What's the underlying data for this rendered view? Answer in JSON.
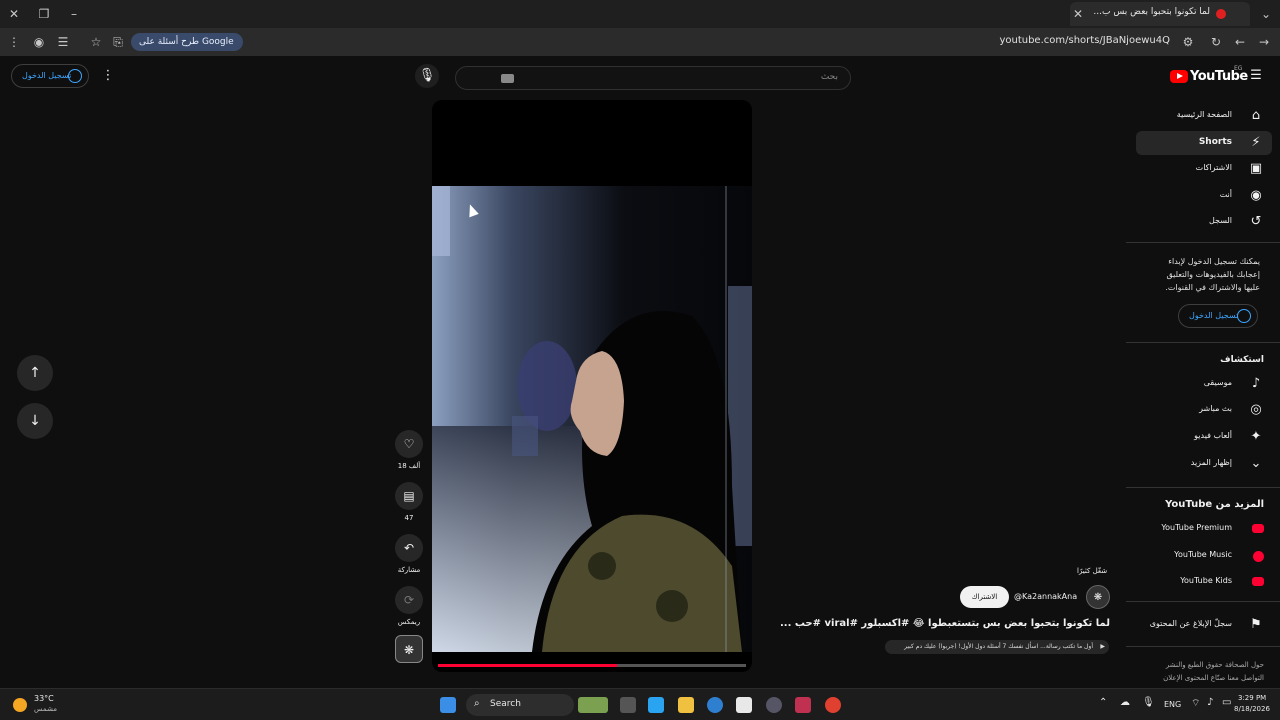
{
  "browser": {
    "tab_title": "لما تكونوا بتحبوا بعض بس ب...",
    "url": "youtube.com/shorts/JBaNjoewu4Q",
    "google_pill": "طرح أسئلة على Google"
  },
  "header": {
    "logo_text": "YouTube",
    "logo_region": "EG",
    "search_placeholder": "بحث",
    "sign_in": "تسجيل الدخول"
  },
  "sidebar": {
    "items": [
      {
        "label": "الصفحة الرئيسية",
        "icon": "home-icon"
      },
      {
        "label": "Shorts",
        "icon": "shorts-icon"
      },
      {
        "label": "الاشتراكات",
        "icon": "subscriptions-icon"
      },
      {
        "label": "أنت",
        "icon": "you-icon"
      },
      {
        "label": "السجل",
        "icon": "history-icon"
      }
    ],
    "signin_prompt": "يمكنك تسجيل الدخول لإبداء إعجابك بالفيديوهات والتعليق عليها والاشتراك في القنوات.",
    "signin_button": "تسجيل الدخول",
    "explore_title": "استكشاف",
    "explore_items": [
      {
        "label": "موسيقى",
        "icon": "music-icon"
      },
      {
        "label": "بث مباشر",
        "icon": "live-icon"
      },
      {
        "label": "ألعاب فيديو",
        "icon": "gaming-icon"
      },
      {
        "label": "إظهار المزيد",
        "icon": "chevron-down-icon"
      }
    ],
    "more_title": "المزيد من YouTube",
    "more_items": [
      {
        "label": "YouTube Premium"
      },
      {
        "label": "YouTube Music"
      },
      {
        "label": "YouTube Kids"
      }
    ],
    "report_label": "سجلّ الإبلاغ عن المحتوى",
    "footer_line1": "حول   الصحافة   حقوق الطبع والنشر",
    "footer_line2": "التواصل معنا   صنّاع المحتوى   الإعلان"
  },
  "short": {
    "likes": "18 ألف",
    "comments": "47",
    "share": "مشاركة",
    "remix": "ريمكس",
    "progress": 0.58,
    "channel_handle": "@Ka2annakAna",
    "subscribe": "الاشتراك",
    "subscribed_label": "شغّل كثيرًا",
    "title": "لما تكونوا بتحبوا بعض بس بتستعبطوا 😂 #اكسبلور #viral #حب ...",
    "music": "أول ما تكتب رسالة... اسأل نفسك 7 أسئلة دول الأول! (جربوا) عليك دم كبير"
  },
  "taskbar": {
    "weather_temp": "33°C",
    "weather_desc": "مشمس",
    "search": "Search",
    "lang": "ENG",
    "time": "3:29 PM",
    "date": "8/18/2026"
  }
}
